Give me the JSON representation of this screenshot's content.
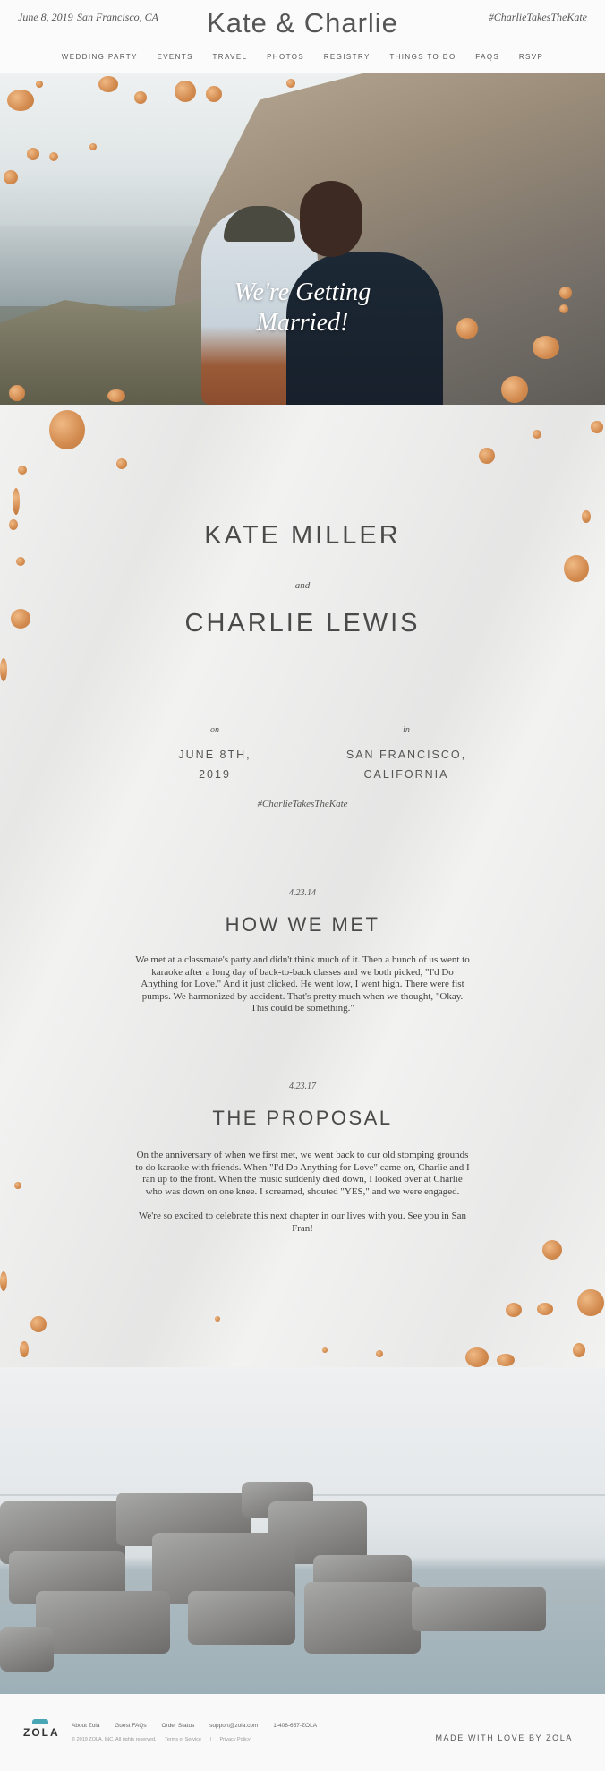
{
  "header": {
    "date": "June 8, 2019",
    "city": "San Francisco, CA",
    "title": "Kate & Charlie",
    "hashtag": "#CharlieTakesTheKate"
  },
  "nav": {
    "items": [
      "WEDDING PARTY",
      "EVENTS",
      "TRAVEL",
      "PHOTOS",
      "REGISTRY",
      "THINGS TO DO",
      "FAQS",
      "RSVP"
    ]
  },
  "hero": {
    "title_line1": "We're Getting",
    "title_line2": "Married!",
    "scroll_icon": "chevron-down-icon"
  },
  "couple": {
    "name1": "KATE MILLER",
    "joiner": "and",
    "name2": "CHARLIE LEWIS"
  },
  "details": {
    "on_label": "on",
    "date_line1": "JUNE 8TH,",
    "date_line2": "2019",
    "in_label": "in",
    "place_line1": "SAN FRANCISCO,",
    "place_line2": "CALIFORNIA",
    "hashtag": "#CharlieTakesTheKate"
  },
  "stories": [
    {
      "date": "4.23.14",
      "title": "HOW WE MET",
      "paragraphs": [
        "We met at a classmate's party and didn't think much of it. Then a bunch of us went to karaoke after a long day of back-to-back classes and we both picked, \"I'd Do Anything for Love.\" And it just clicked. He went low, I went high. There were fist pumps. We harmonized by accident. That's pretty much when we thought, \"Okay. This could be something.\""
      ]
    },
    {
      "date": "4.23.17",
      "title": "THE PROPOSAL",
      "paragraphs": [
        "On the anniversary of when we first met, we went back to our old stomping grounds to do karaoke with friends. When \"I'd Do Anything for Love\" came on, Charlie and I ran up to the front. When the music suddenly died down, I looked over at Charlie who was down on one knee. I screamed, shouted \"YES,\" and we were engaged.",
        "We're so excited to celebrate this next chapter in our lives with you. See you in San Fran!"
      ]
    }
  ],
  "footer": {
    "logo": "ZOLA",
    "links": [
      "About Zola",
      "Guest FAQs",
      "Order Status",
      "support@zola.com",
      "1-408-657-ZOLA"
    ],
    "copyright": "© 2019 ZOLA, INC. All rights reserved.",
    "terms": "Terms of Service",
    "separator": "|",
    "privacy": "Privacy Policy",
    "made_with": "MADE WITH LOVE BY ZOLA"
  },
  "colors": {
    "accent_gold": "#d28a4e",
    "text": "#4a4a4a",
    "marble": "#f2f2f1",
    "zola_mark": "#4aa6b5"
  }
}
